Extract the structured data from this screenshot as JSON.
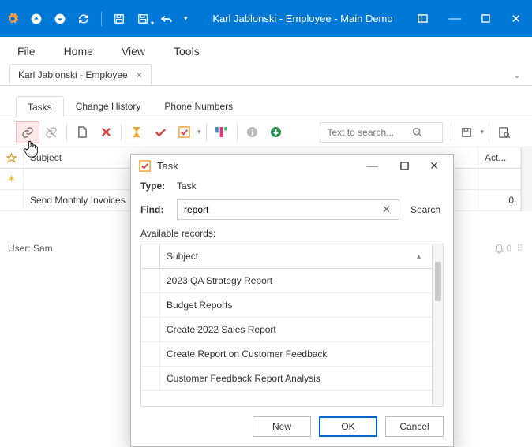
{
  "window": {
    "title": "Karl Jablonski - Employee - Main Demo"
  },
  "menu": [
    "File",
    "Home",
    "View",
    "Tools"
  ],
  "doc_tab": {
    "title": "Karl Jablonski - Employee"
  },
  "inner_tabs": [
    {
      "label": "Tasks",
      "active": true
    },
    {
      "label": "Change History"
    },
    {
      "label": "Phone Numbers"
    }
  ],
  "search": {
    "placeholder": "Text to search..."
  },
  "grid": {
    "columns": {
      "subject": "Subject",
      "act": "Act..."
    },
    "rows": [
      {
        "subject": "",
        "act": ""
      },
      {
        "subject": "Send Monthly Invoices",
        "act": "0"
      }
    ]
  },
  "status": {
    "user_label": "User: Sam",
    "notif_count": "0"
  },
  "dialog": {
    "title": "Task",
    "type_label": "Type:",
    "type_value": "Task",
    "find_label": "Find:",
    "find_value": "report",
    "search_btn": "Search",
    "available_label": "Available records:",
    "col_subject": "Subject",
    "records": [
      "2023 QA Strategy Report",
      "Budget Reports",
      "Create 2022 Sales Report",
      "Create Report on Customer Feedback",
      "Customer Feedback Report Analysis"
    ],
    "buttons": {
      "new": "New",
      "ok": "OK",
      "cancel": "Cancel"
    }
  }
}
